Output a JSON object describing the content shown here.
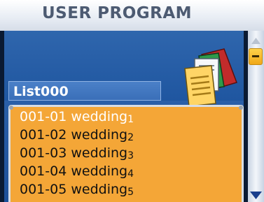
{
  "header": {
    "title": "USER PROGRAM"
  },
  "list": {
    "name": "List000",
    "items": [
      {
        "code": "001-01",
        "label": "wedding",
        "number": "1",
        "selected": true
      },
      {
        "code": "001-02",
        "label": "wedding",
        "number": "2",
        "selected": false
      },
      {
        "code": "001-03",
        "label": "wedding",
        "number": "3",
        "selected": false
      },
      {
        "code": "001-04",
        "label": "wedding",
        "number": "4",
        "selected": false
      },
      {
        "code": "001-05",
        "label": "wedding",
        "number": "5",
        "selected": false
      }
    ]
  },
  "icons": {
    "program": "documents-icon",
    "scroll_up": "scroll-up-arrow-icon",
    "scroll_down": "scroll-down-arrow-icon",
    "scroll_thumb": "scroll-thumb-minus-icon"
  },
  "colors": {
    "list_background": "#f4a637",
    "panel_blue": "#1f56a0",
    "title_text": "#4d5b72",
    "selected_text": "#ffffff",
    "item_text": "#111111"
  }
}
